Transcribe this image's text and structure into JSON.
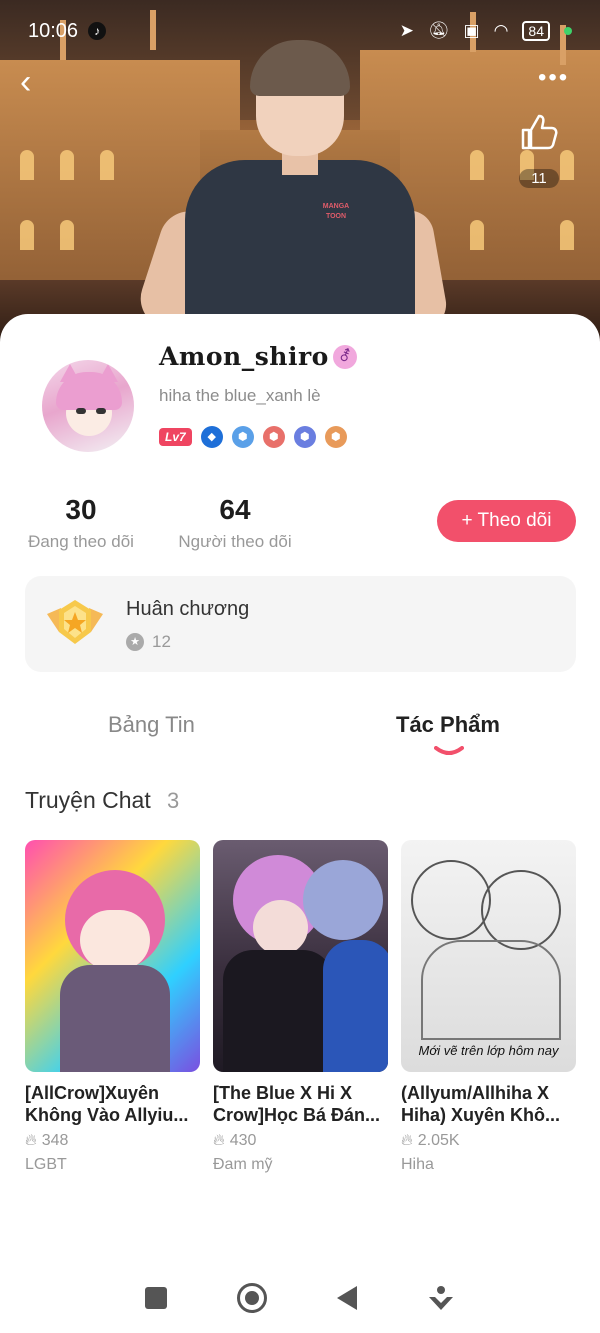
{
  "status_bar": {
    "time": "10:06",
    "battery": "84",
    "icons": [
      "tiktok-icon",
      "location-icon",
      "mute-icon",
      "sim-icon",
      "wifi-icon",
      "battery-icon"
    ]
  },
  "header": {
    "back_icon": "chevron-left-icon",
    "more_icon": "more-dots-icon",
    "like_icon": "thumbs-up-icon",
    "like_count": "11"
  },
  "profile": {
    "username": "Amon_shiro",
    "gender_symbol": "⚦",
    "bio": "hiha the blue_xanh lè",
    "level": "Lv7",
    "badges": [
      "water-badge",
      "shield-blue-badge",
      "shield-red-badge",
      "shield-purple-badge",
      "shield-orange-badge"
    ]
  },
  "stats": {
    "following": {
      "value": "30",
      "label": "Đang theo dõi"
    },
    "followers": {
      "value": "64",
      "label": "Người theo dõi"
    }
  },
  "follow_button": {
    "label": "+ Theo dõi"
  },
  "medals": {
    "title": "Huân chương",
    "count": "12"
  },
  "tabs": [
    {
      "label": "Bảng Tin",
      "active": false
    },
    {
      "label": "Tác Phẩm",
      "active": true
    }
  ],
  "section": {
    "title": "Truyện Chat",
    "count": "3"
  },
  "stories": [
    {
      "title": "[AllCrow]Xuyên Không Vào Allyiu...",
      "reads": "348",
      "tag": "LGBT"
    },
    {
      "title": "[The Blue X Hi X Crow]Học Bá Đán...",
      "reads": "430",
      "tag": "Đam mỹ"
    },
    {
      "title": "(Allyum/Allhiha X Hiha) Xuyên Khô...",
      "reads": "2.05K",
      "tag": "Hiha",
      "cover_caption": "Mới vẽ trên lớp hôm nay"
    }
  ],
  "colors": {
    "accent": "#f2506b",
    "level_badge": "#ef4561",
    "card_bg": "#f5f5f5"
  }
}
